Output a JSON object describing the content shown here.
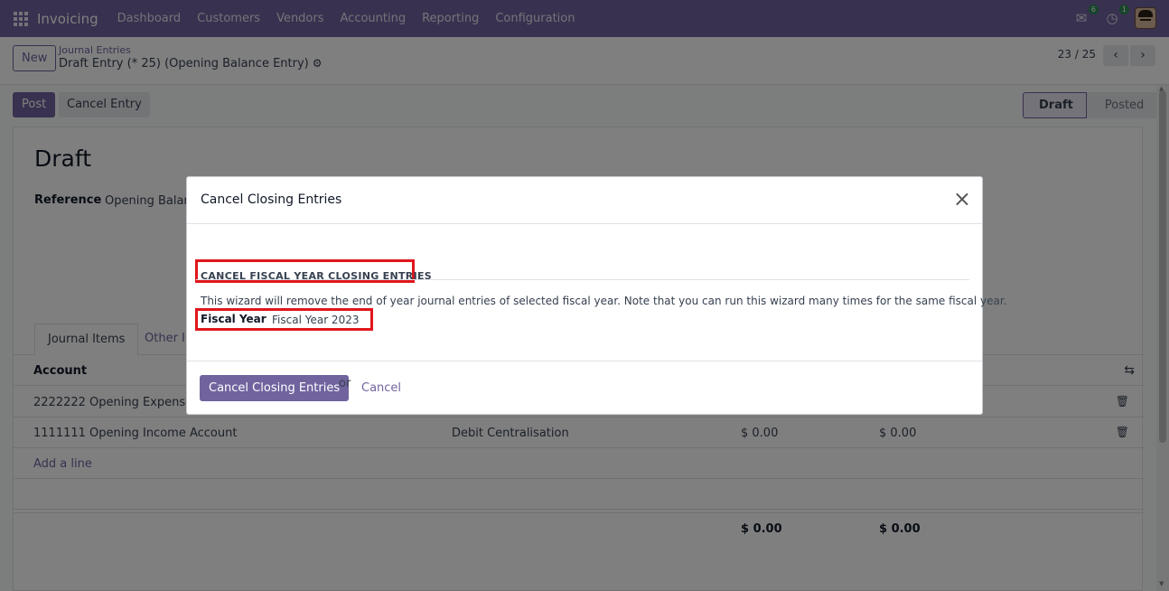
{
  "navbar": {
    "brand": "Invoicing",
    "menu": [
      "Dashboard",
      "Customers",
      "Vendors",
      "Accounting",
      "Reporting",
      "Configuration"
    ],
    "messages_badge": "6",
    "activities_badge": "1"
  },
  "control_panel": {
    "new_label": "New",
    "breadcrumb_parent": "Journal Entries",
    "breadcrumb_current": "Draft Entry (* 25) (Opening Balance Entry)",
    "pager": "23 / 25"
  },
  "actions": {
    "post_label": "Post",
    "cancel_entry_label": "Cancel Entry"
  },
  "status": {
    "draft": "Draft",
    "posted": "Posted"
  },
  "form": {
    "title": "Draft",
    "reference_label": "Reference",
    "reference_value": "Opening Balance Entry",
    "tabs": [
      "Journal Items",
      "Other Info"
    ],
    "column_account": "Account",
    "rows": [
      {
        "account": "2222222 Opening Expense Account",
        "label": "",
        "debit": "",
        "credit": ""
      },
      {
        "account": "1111111 Opening Income Account",
        "label": "Debit Centralisation",
        "debit": "$ 0.00",
        "credit": "$ 0.00"
      }
    ],
    "add_line": "Add a line",
    "total_debit": "$ 0.00",
    "total_credit": "$ 0.00"
  },
  "modal": {
    "title": "Cancel Closing Entries",
    "separator": "CANCEL FISCAL YEAR CLOSING ENTRIES",
    "description": "This wizard will remove the end of year journal entries of selected fiscal year. Note that you can run this wizard many times for the same fiscal year.",
    "fiscal_year_label": "Fiscal Year",
    "fiscal_year_value": "Fiscal Year 2023",
    "confirm_label": "Cancel Closing Entries",
    "or_text": "or",
    "cancel_label": "Cancel"
  },
  "colors": {
    "brand": "#71639e",
    "highlight": "#e0161c"
  }
}
